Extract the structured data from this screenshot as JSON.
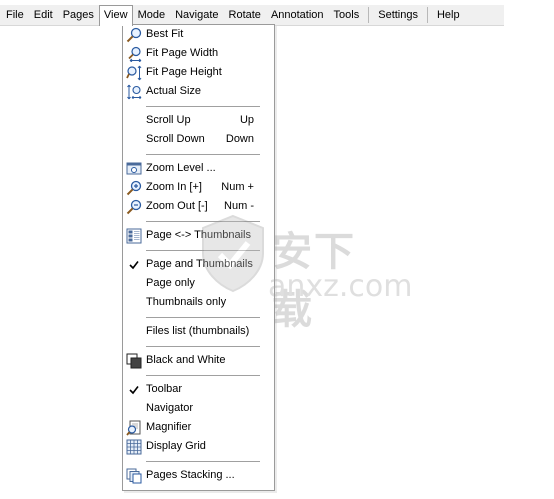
{
  "menubar": {
    "items": [
      "File",
      "Edit",
      "Pages",
      "View",
      "Mode",
      "Navigate",
      "Rotate",
      "Annotation",
      "Tools",
      "Settings",
      "Help"
    ]
  },
  "menu": {
    "best_fit": "Best Fit",
    "fit_width": "Fit Page Width",
    "fit_height": "Fit Page Height",
    "actual_size": "Actual Size",
    "scroll_up": "Scroll Up",
    "scroll_up_sc": "Up",
    "scroll_down": "Scroll Down",
    "scroll_down_sc": "Down",
    "zoom_level": "Zoom Level ...",
    "zoom_in": "Zoom In [+]",
    "zoom_in_sc": "Num +",
    "zoom_out": "Zoom Out [-]",
    "zoom_out_sc": "Num -",
    "page_thumbs_toggle": "Page <-> Thumbnails",
    "page_and_thumbs": "Page and Thumbnails",
    "page_only": "Page only",
    "thumbs_only": "Thumbnails only",
    "files_list": "Files list (thumbnails)",
    "black_white": "Black and White",
    "toolbar": "Toolbar",
    "navigator": "Navigator",
    "magnifier": "Magnifier",
    "display_grid": "Display Grid",
    "pages_stacking": "Pages Stacking ..."
  },
  "watermark": {
    "text": "安下载",
    "sub": "anxz.com"
  }
}
